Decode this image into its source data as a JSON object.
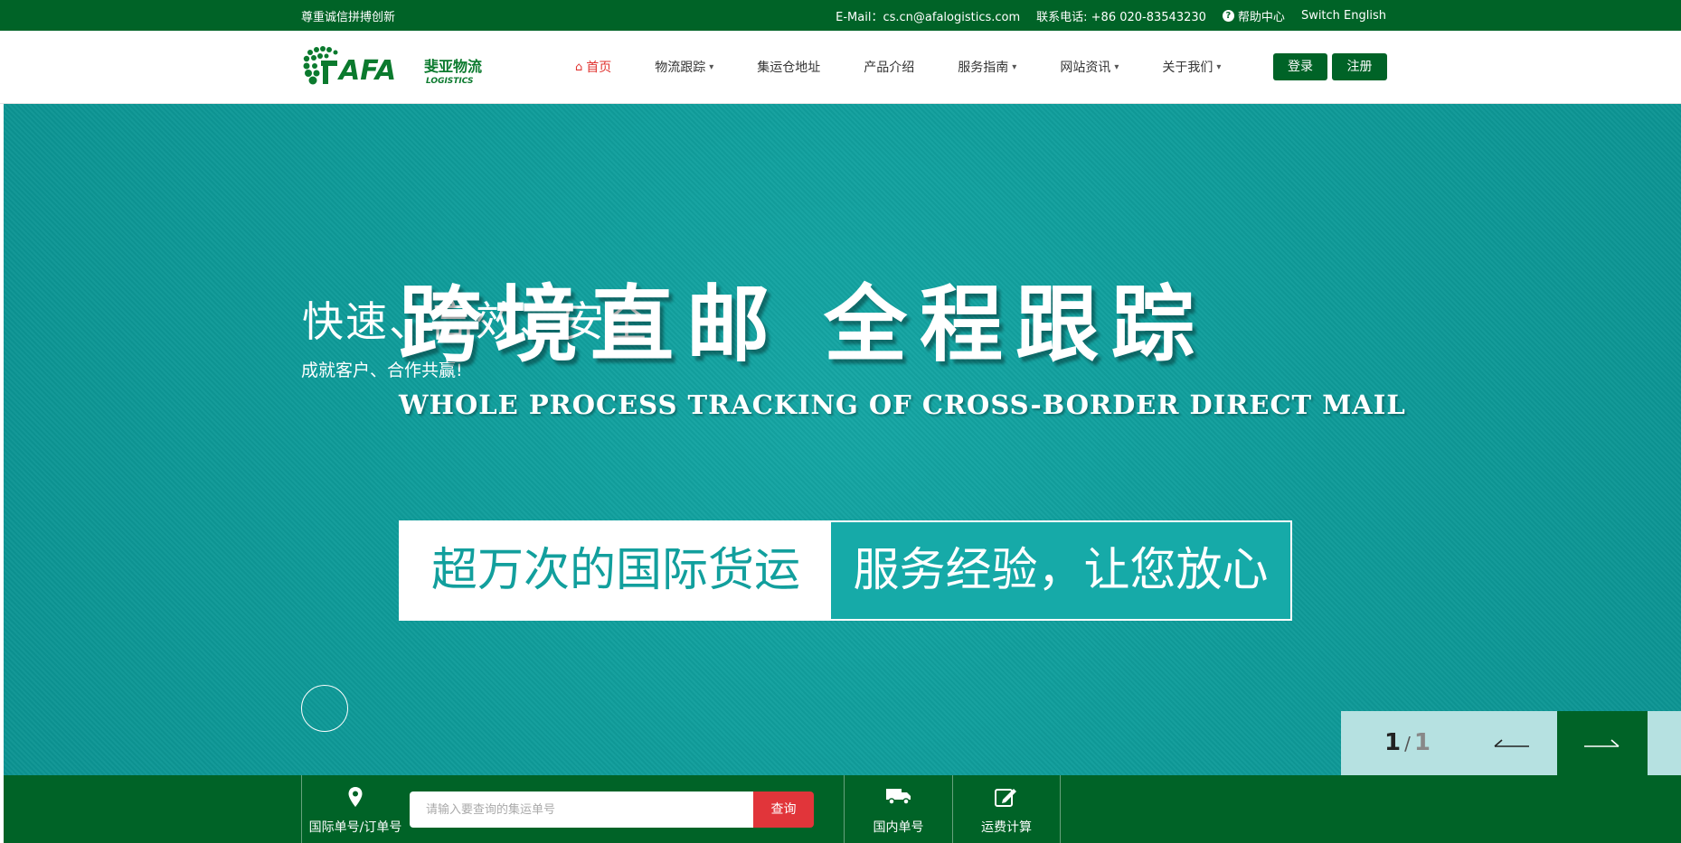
{
  "topbar": {
    "slogan": "尊重诚信拼搏创新",
    "email": "E-Mail：cs.cn@afalogistics.com",
    "phone": "联系电话: +86 020-83543230",
    "help": "帮助中心",
    "switch_lang": "Switch English"
  },
  "logo": {
    "brand": "AFA",
    "cn": "斐亚物流",
    "en": "LOGISTICS"
  },
  "nav": {
    "items": [
      {
        "label": "首页",
        "active": true,
        "dropdown": false
      },
      {
        "label": "物流跟踪",
        "active": false,
        "dropdown": true
      },
      {
        "label": "集运仓地址",
        "active": false,
        "dropdown": false
      },
      {
        "label": "产品介绍",
        "active": false,
        "dropdown": false
      },
      {
        "label": "服务指南",
        "active": false,
        "dropdown": true
      },
      {
        "label": "网站资讯",
        "active": false,
        "dropdown": true
      },
      {
        "label": "关于我们",
        "active": false,
        "dropdown": true
      }
    ],
    "login": "登录",
    "register": "注册"
  },
  "hero": {
    "small_line1": "快速、高效、安全",
    "small_line2": "成就客户、合作共赢!",
    "big_title": "跨境直邮  全程跟踪",
    "en_title": "WHOLE PROCESS TRACKING OF CROSS-BORDER DIRECT MAIL",
    "banner_left": "超万次的国际货运",
    "banner_right": "服务经验，让您放心"
  },
  "slider": {
    "current": "1",
    "separator": "/",
    "total": "1"
  },
  "bottom": {
    "tool1_label": "国际单号/订单号",
    "search_placeholder": "请输入要查询的集运单号",
    "search_button": "查询",
    "tool2_label": "国内单号",
    "tool3_label": "运费计算"
  },
  "colors": {
    "brand_green": "#006327",
    "hero_teal": "#0e9b99",
    "accent_red": "#e1353a"
  }
}
